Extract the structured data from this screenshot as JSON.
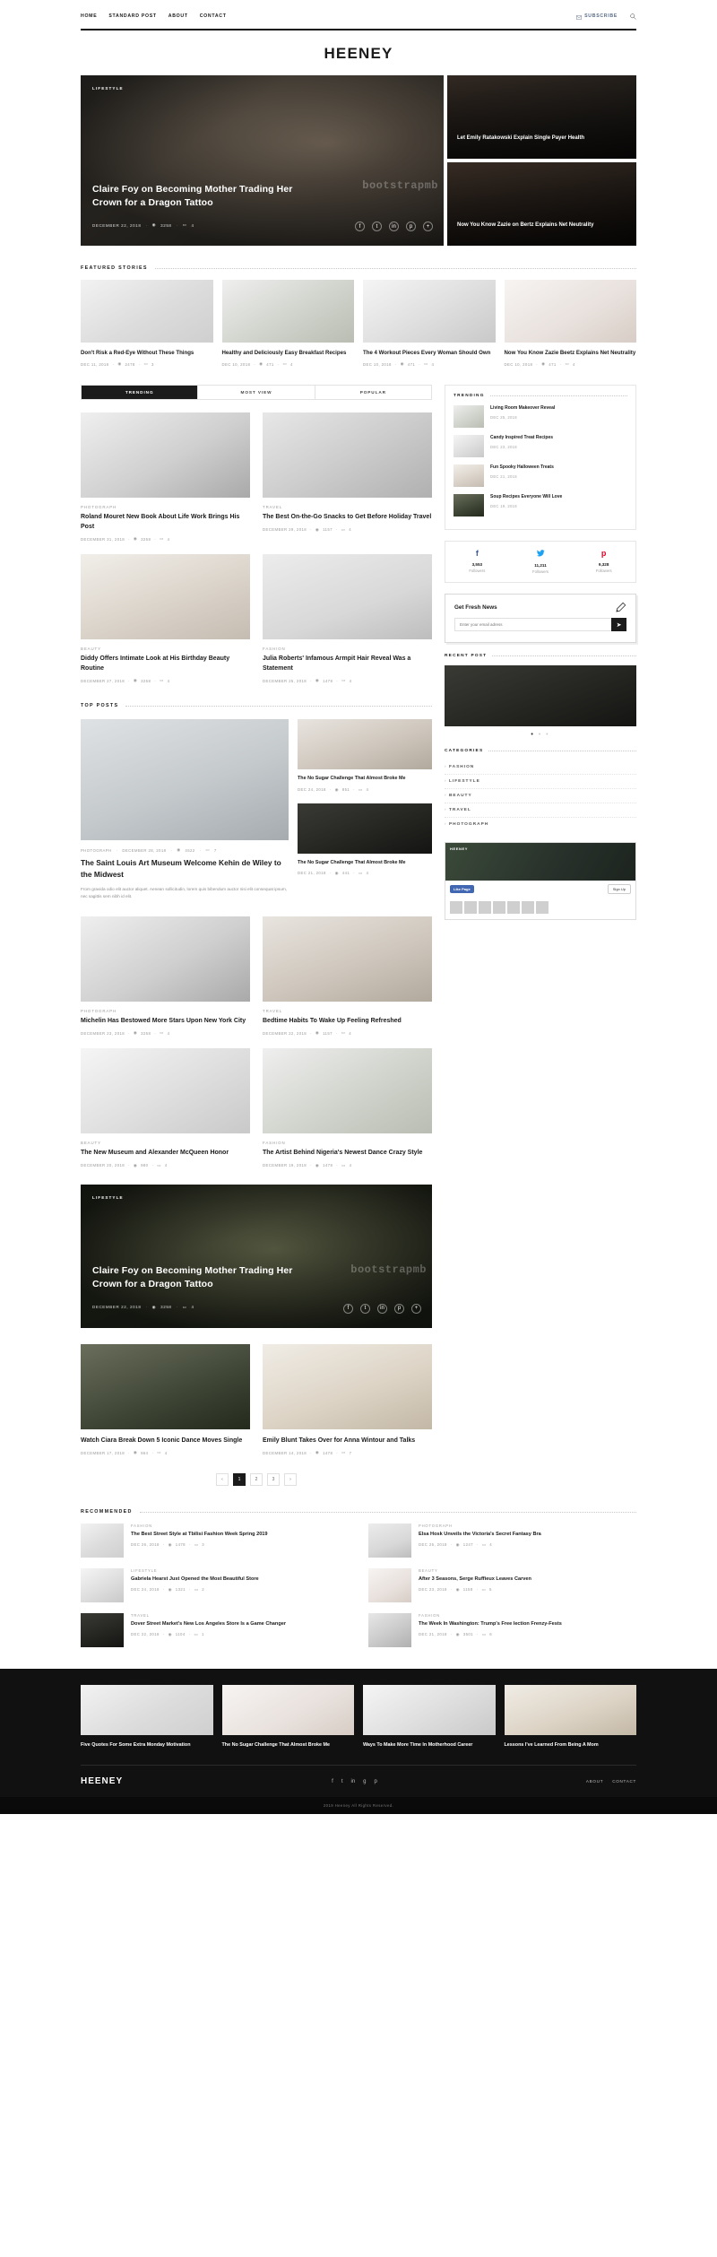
{
  "nav": {
    "items": [
      "HOME",
      "STANDARD POST",
      "ABOUT",
      "CONTACT"
    ],
    "subscribe": "SUBSCRIBE",
    "search_icon": "search-icon",
    "mail_icon": "mail-icon"
  },
  "site": {
    "logo": "HEENEY",
    "watermark": "bootstrapmb"
  },
  "hero": {
    "main": {
      "category": "LIFESTYLE",
      "title": "Claire Foy on Becoming Mother Trading Her Crown for a Dragon Tattoo",
      "date": "DECEMBER 22, 2018",
      "views": "3258",
      "comments": "4",
      "socials": [
        "f",
        "t",
        "in",
        "p",
        "+"
      ]
    },
    "cards": [
      {
        "title": "Let Emily Ratakowski Explain Single Payer Health"
      },
      {
        "title": "Now You Know Zazie on Bertz Explains Net Neutrality"
      }
    ]
  },
  "featured": {
    "heading": "FEATURED STORIES",
    "items": [
      {
        "title": "Don't Risk a Red-Eye Without These Things",
        "date": "DEC 11, 2018",
        "views": "2478",
        "comments": "3"
      },
      {
        "title": "Healthy and Deliciously Easy Breakfast Recipes",
        "date": "DEC 10, 2018",
        "views": "471",
        "comments": "4"
      },
      {
        "title": "The 4 Workout Pieces Every Woman Should Own",
        "date": "DEC 10, 2018",
        "views": "471",
        "comments": "4"
      },
      {
        "title": "Now You Know Zazie Beetz Explains Net Neutrality",
        "date": "DEC 10, 2018",
        "views": "471",
        "comments": "4"
      }
    ]
  },
  "tabs": [
    {
      "label": "TRENDING",
      "active": true
    },
    {
      "label": "MOST VIEW",
      "active": false
    },
    {
      "label": "POPULAR",
      "active": false
    }
  ],
  "posts": [
    {
      "category": "PHOTOGRAPH",
      "title": "Roland Mouret New Book About Life Work Brings His Post",
      "date": "DECEMBER 31, 2018",
      "views": "3258",
      "comments": "4"
    },
    {
      "category": "TRAVEL",
      "title": "The Best On-the-Go Snacks to Get Before Holiday Travel",
      "date": "DECEMBER 29, 2018",
      "views": "1157",
      "comments": "4"
    },
    {
      "category": "BEAUTY",
      "title": "Diddy Offers Intimate Look at His Birthday Beauty Routine",
      "date": "DECEMBER 27, 2018",
      "views": "3258",
      "comments": "4"
    },
    {
      "category": "FASHION",
      "title": "Julia Roberts' Infamous Armpit Hair Reveal Was a Statement",
      "date": "DECEMBER 25, 2018",
      "views": "1478",
      "comments": "4"
    }
  ],
  "sidebar": {
    "trending": {
      "heading": "TRENDING",
      "items": [
        {
          "title": "Living Room Makeover Reveal",
          "date": "DEC 25, 2018"
        },
        {
          "title": "Candy Inspired Treat Recipes",
          "date": "DEC 23, 2018"
        },
        {
          "title": "Fun Spooky Halloween Treats",
          "date": "DEC 21, 2018"
        },
        {
          "title": "Soup Recipes Everyone Will Love",
          "date": "DEC 19, 2018"
        }
      ]
    },
    "social": [
      {
        "icon": "facebook-icon",
        "glyph": "f",
        "count": "3,553",
        "label": "Followers",
        "color": "#3b5998"
      },
      {
        "icon": "twitter-icon",
        "glyph": "t",
        "count": "11,211",
        "label": "Followers",
        "color": "#1da1f2"
      },
      {
        "icon": "pinterest-icon",
        "glyph": "p",
        "count": "9,328",
        "label": "Followers",
        "color": "#e60023"
      }
    ],
    "newsletter": {
      "title": "Get Fresh News",
      "placeholder": "Enter your email adress",
      "button_icon": "send-icon",
      "pen_icon": "pen-icon"
    },
    "recent": {
      "heading": "RECENT POST",
      "dots": "• • •"
    },
    "categories": {
      "heading": "CATEGORIES",
      "items": [
        "FASHION",
        "LIFESTYLE",
        "BEAUTY",
        "TRAVEL",
        "PHOTOGRAPH"
      ]
    },
    "facebook": {
      "page_name": "HEENEY",
      "like_label": "Like Page",
      "signup_label": "Sign Up"
    }
  },
  "top_posts": {
    "heading": "TOP POSTS",
    "featured": {
      "category": "PHOTOGRAPH",
      "date": "DECEMBER 28, 2018",
      "views": "4522",
      "comments": "7",
      "title": "The Saint Louis Art Museum Welcome Kehin de Wiley to the Midwest",
      "excerpt": "From gravida odio elit auctor aliquet. Aenean sollicitudin, lorem quis bibendum auctor nisi elit consequat ipsum, nec sagittis sem nibh id elit."
    },
    "side": [
      {
        "title": "The No Sugar Challenge That Almost Broke Me",
        "date": "DEC 24, 2018",
        "views": "851",
        "comments": "4"
      },
      {
        "title": "The No Sugar Challenge That Almost Broke Me",
        "date": "DEC 21, 2018",
        "views": "441",
        "comments": "4"
      }
    ]
  },
  "more_posts": [
    {
      "category": "PHOTOGRAPH",
      "title": "Michelin Has Bestowed More Stars Upon New York City",
      "date": "DECEMBER 23, 2018",
      "views": "3258",
      "comments": "4"
    },
    {
      "category": "TRAVEL",
      "title": "Bedtime Habits To Wake Up Feeling Refreshed",
      "date": "DECEMBER 22, 2018",
      "views": "1157",
      "comments": "4"
    },
    {
      "category": "BEAUTY",
      "title": "The New Museum and Alexander McQueen Honor",
      "date": "DECEMBER 20, 2018",
      "views": "980",
      "comments": "4"
    },
    {
      "category": "FASHION",
      "title": "The Artist Behind Nigeria's Newest Dance Crazy Style",
      "date": "DECEMBER 19, 2018",
      "views": "1478",
      "comments": "4"
    }
  ],
  "hero2": {
    "category": "LIFESTYLE",
    "title": "Claire Foy on Becoming Mother Trading Her Crown for a Dragon Tattoo",
    "date": "DECEMBER 22, 2018",
    "views": "3258",
    "comments": "4"
  },
  "last_posts": [
    {
      "category": "TRAVEL",
      "title": "Watch Ciara Break Down 5 Iconic Dance Moves Single",
      "date": "DECEMBER 17, 2018",
      "views": "964",
      "comments": "4"
    },
    {
      "category": "LIFESTYLE",
      "title": "Emily Blunt Takes Over for Anna Wintour and Talks",
      "date": "DECEMBER 14, 2018",
      "views": "1478",
      "comments": "7"
    }
  ],
  "pagination": {
    "prev": "‹",
    "pages": [
      "1",
      "2",
      "3"
    ],
    "next": "›",
    "active": "1"
  },
  "recommended": {
    "heading": "RECOMMENDED",
    "items": [
      {
        "category": "FASHION",
        "title": "The Best Street Style at Tbilisi Fashion Week Spring 2019",
        "date": "DEC 26, 2018",
        "views": "1478",
        "comments": "3"
      },
      {
        "category": "PHOTOGRAPH",
        "title": "Elsa Hosk Unveils the Victoria's Secret Fantasy Bra",
        "date": "DEC 25, 2018",
        "views": "1247",
        "comments": "4"
      },
      {
        "category": "LIFESTYLE",
        "title": "Gabriela Hearst Just Opened the Most Beautiful Store",
        "date": "DEC 24, 2018",
        "views": "1321",
        "comments": "2"
      },
      {
        "category": "BEAUTY",
        "title": "After 3 Seasons, Serge Ruffieux Leaves Carven",
        "date": "DEC 23, 2018",
        "views": "1158",
        "comments": "5"
      },
      {
        "category": "TRAVEL",
        "title": "Dover Street Market's New Los Angeles Store Is a Game Changer",
        "date": "DEC 22, 2018",
        "views": "1104",
        "comments": "1"
      },
      {
        "category": "FASHION",
        "title": "The Week In Washington: Trump's Free lection Frenzy-Fests",
        "date": "DEC 21, 2018",
        "views": "3501",
        "comments": "6"
      }
    ]
  },
  "footer": {
    "posts": [
      {
        "title": "Five Quotes For Some Extra Monday Motivation"
      },
      {
        "title": "The No Sugar Challenge That Almost Broke Me"
      },
      {
        "title": "Ways To Make More Time In Motherhood Career"
      },
      {
        "title": "Lessons I've Learned From Being A Mom"
      }
    ],
    "logo": "HEENEY",
    "socials": [
      "f",
      "t",
      "in",
      "g",
      "p"
    ],
    "links": [
      "ABOUT",
      "CONTACT"
    ],
    "copyright": "2019 Heeney All Rights Reserved."
  }
}
